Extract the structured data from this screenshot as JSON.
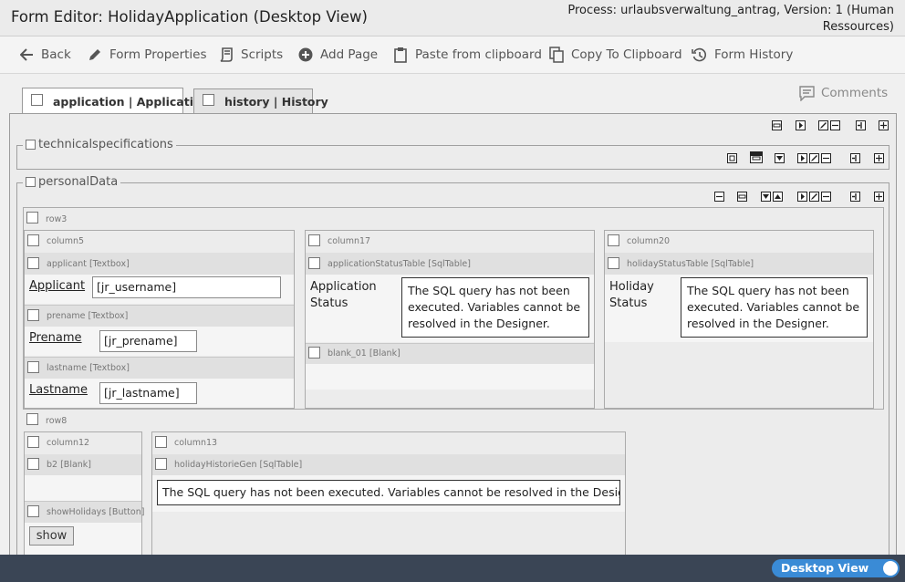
{
  "header": {
    "title": "Form Editor: HolidayApplication (Desktop View)",
    "process": "Process: urlaubsverwaltung_antrag, Version: 1 (Human Ressources)"
  },
  "toolbar": {
    "back": "Back",
    "form_properties": "Form Properties",
    "scripts": "Scripts",
    "add_page": "Add Page",
    "paste": "Paste from clipboard",
    "copy": "Copy To Clipboard",
    "history": "Form History"
  },
  "tabs": [
    {
      "label": "application | Application",
      "active": true
    },
    {
      "label": "history | History",
      "active": false
    }
  ],
  "comments": "Comments",
  "sections": {
    "technical": "technicalspecifications",
    "personal": "personalData"
  },
  "rows": {
    "row3": "row3",
    "row8": "row8"
  },
  "columns": {
    "column5": "column5",
    "column17": "column17",
    "column20": "column20",
    "column12": "column12",
    "column13": "column13"
  },
  "elements": {
    "applicant_id": "applicant [Textbox]",
    "applicant_label": "Applicant",
    "applicant_value": "[jr_username]",
    "prename_id": "prename [Textbox]",
    "prename_label": "Prename",
    "prename_value": "[jr_prename]",
    "lastname_id": "lastname [Textbox]",
    "lastname_label": "Lastname",
    "lastname_value": "[jr_lastname]",
    "appstatus_id": "applicationStatusTable [SqlTable]",
    "appstatus_label": "Application Status",
    "blank01_id": "blank_01 [Blank]",
    "holidaystatus_id": "holidayStatusTable [SqlTable]",
    "holidaystatus_label": "Holiday Status",
    "b2_id": "b2 [Blank]",
    "showholidays_id": "showHolidays [Button]",
    "show_button": "show",
    "histgen_id": "holidayHistorieGen [SqlTable]"
  },
  "sql_message_wrapped": "The SQL query has not been executed. Variables cannot be resolved in the Designer.",
  "sql_message": "The SQL query has not been executed. Variables cannot be resolved in the Designer.",
  "footer": {
    "view_toggle": "Desktop View",
    "view_toggle_on": true
  },
  "colors": {
    "footer_bg": "#3a4555",
    "toggle_bg": "#3a8bd6"
  }
}
